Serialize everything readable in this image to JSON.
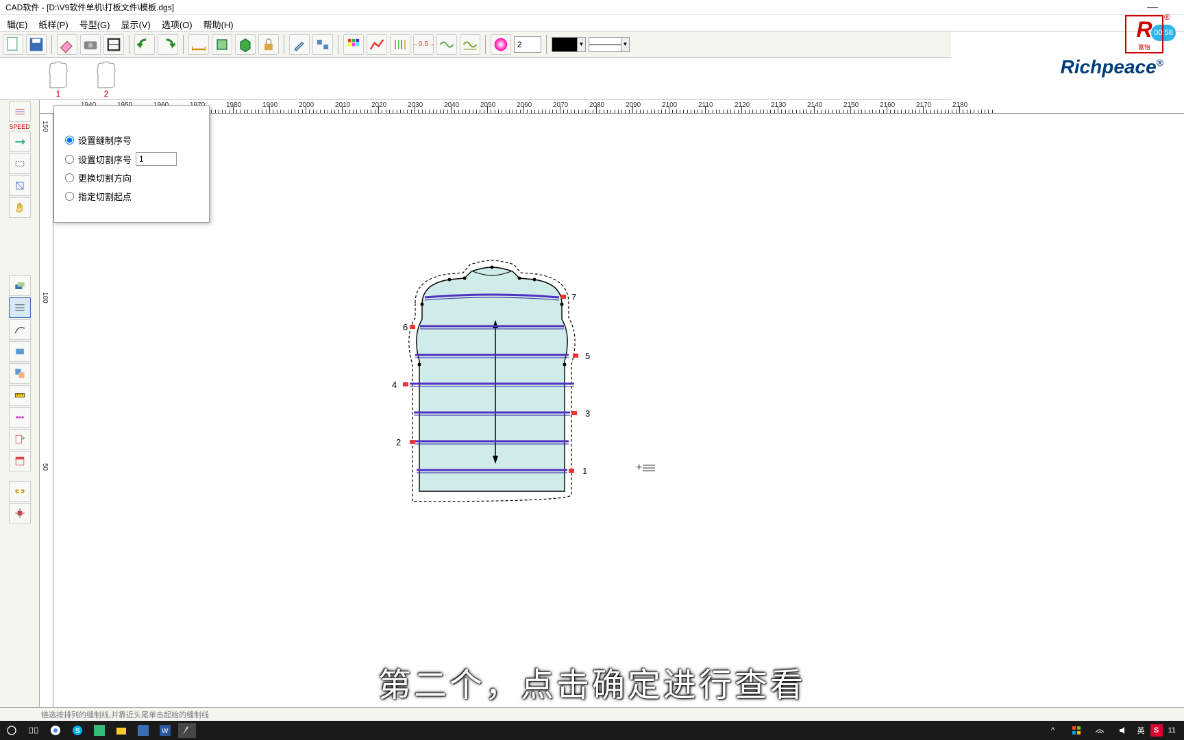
{
  "title": "CAD软件 - [D:\\V9软件单机\\打板文件\\模板.dgs]",
  "menu": {
    "edit": "辑(E)",
    "paper": "纸样(P)",
    "size": "号型(G)",
    "display": "显示(V)",
    "options": "选项(O)",
    "help": "帮助(H)"
  },
  "toolbar": {
    "numeric_input": "2"
  },
  "thumbs": {
    "t1": "1",
    "t2": "2"
  },
  "ruler": {
    "h": [
      "1940",
      "1950",
      "1960",
      "1970",
      "1980",
      "1990",
      "2000",
      "2010",
      "2020",
      "2030",
      "2040",
      "2050",
      "2060",
      "2070",
      "2080",
      "2090",
      "2100",
      "2110",
      "2120",
      "2130",
      "2140",
      "2150",
      "2160",
      "2170",
      "2180"
    ],
    "v": [
      "150",
      "100",
      "50"
    ]
  },
  "panel": {
    "opt1": "设置缝制序号",
    "opt2": "设置切割序号",
    "opt3": "更换切割方向",
    "opt4": "指定切割起点",
    "field_value": "1"
  },
  "garment": {
    "labels": {
      "n1": "1",
      "n2": "2",
      "n3": "3",
      "n4": "4",
      "n5": "5",
      "n6": "6",
      "n7": "7"
    }
  },
  "brand": {
    "logo_cn": "富怡",
    "name": "Richpeace",
    "reg": "®"
  },
  "badge": "00:58",
  "status": "链选按排列的缝制线,并靠近头尾单击起始的缝制线",
  "subtitle": "第二个，点击确定进行查看",
  "tray": {
    "ime_lang": "英",
    "time": "11"
  }
}
